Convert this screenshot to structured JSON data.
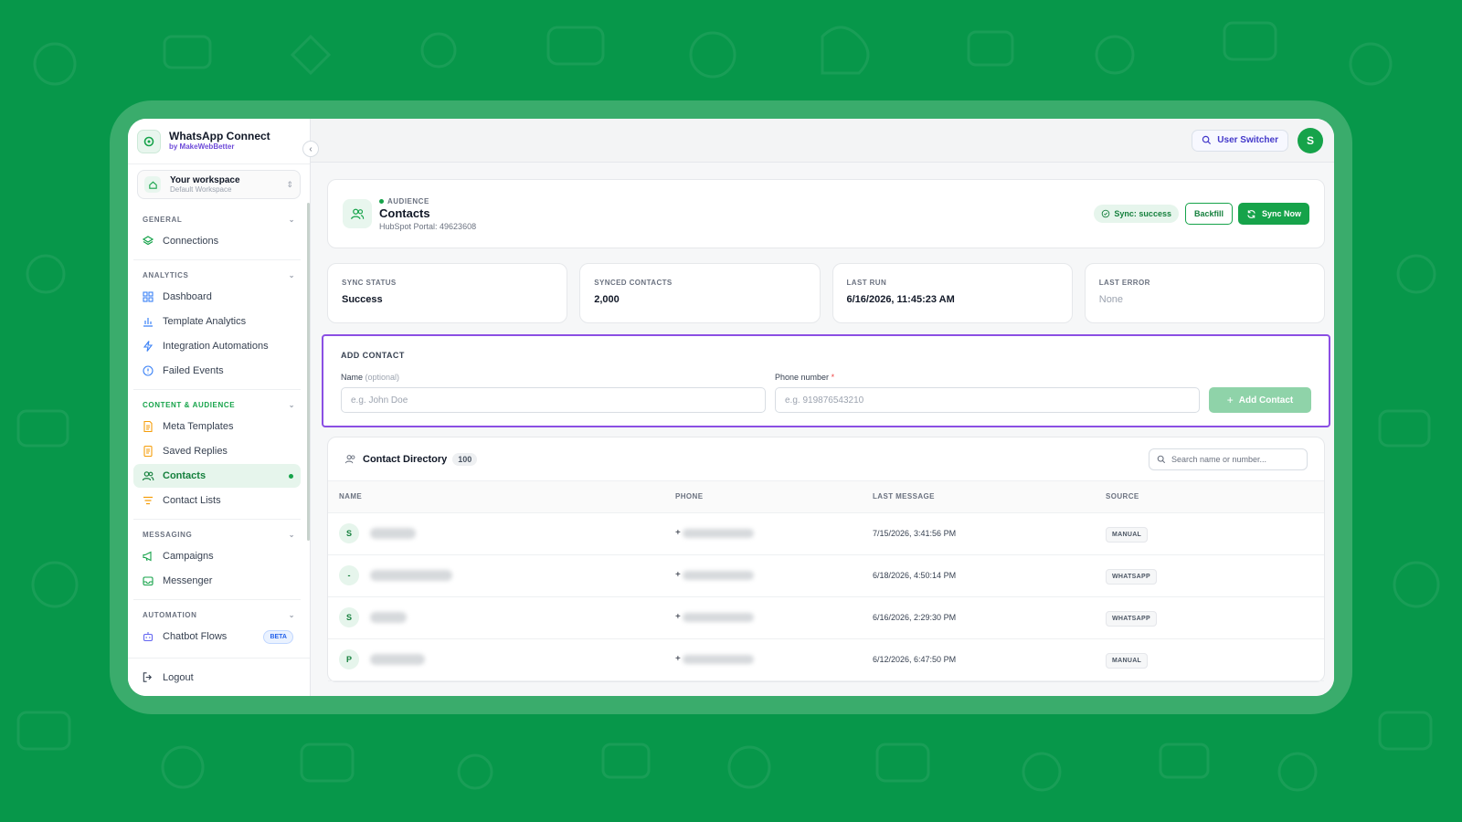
{
  "brand": {
    "title": "WhatsApp Connect",
    "subtitle": "by MakeWebBetter"
  },
  "workspace": {
    "name": "Your workspace",
    "sub": "Default Workspace"
  },
  "sidebar": {
    "sections": [
      {
        "label": "GENERAL",
        "items": [
          {
            "label": "Connections",
            "icon": "layers-icon"
          }
        ]
      },
      {
        "label": "ANALYTICS",
        "items": [
          {
            "label": "Dashboard",
            "icon": "dashboard-icon"
          },
          {
            "label": "Template Analytics",
            "icon": "bar-chart-icon"
          },
          {
            "label": "Integration Automations",
            "icon": "bolt-icon"
          },
          {
            "label": "Failed Events",
            "icon": "alert-circle-icon"
          }
        ]
      },
      {
        "label": "CONTENT & AUDIENCE",
        "items": [
          {
            "label": "Meta Templates",
            "icon": "document-icon"
          },
          {
            "label": "Saved Replies",
            "icon": "notes-icon"
          },
          {
            "label": "Contacts",
            "icon": "users-icon",
            "active": true
          },
          {
            "label": "Contact Lists",
            "icon": "list-filter-icon"
          }
        ]
      },
      {
        "label": "MESSAGING",
        "items": [
          {
            "label": "Campaigns",
            "icon": "megaphone-icon"
          },
          {
            "label": "Messenger",
            "icon": "inbox-icon"
          }
        ]
      },
      {
        "label": "AUTOMATION",
        "items": [
          {
            "label": "Chatbot Flows",
            "icon": "bot-icon",
            "badge": "BETA"
          }
        ]
      }
    ],
    "logout": "Logout"
  },
  "topbar": {
    "user_switcher": "User Switcher",
    "avatar_initial": "S"
  },
  "header": {
    "eyebrow": "AUDIENCE",
    "title": "Contacts",
    "subtitle": "HubSpot Portal: 49623608",
    "sync_pill": "Sync: success",
    "backfill": "Backfill",
    "sync_now": "Sync Now"
  },
  "stats": [
    {
      "label": "SYNC STATUS",
      "value": "Success"
    },
    {
      "label": "SYNCED CONTACTS",
      "value": "2,000"
    },
    {
      "label": "LAST RUN",
      "value": "6/16/2026, 11:45:23 AM"
    },
    {
      "label": "LAST ERROR",
      "value": "None"
    }
  ],
  "add_contact": {
    "title": "ADD CONTACT",
    "name_label": "Name",
    "name_optional": "(optional)",
    "name_placeholder": "e.g. John Doe",
    "phone_label": "Phone number",
    "phone_required": "*",
    "phone_placeholder": "e.g. 919876543210",
    "button": "Add Contact"
  },
  "directory": {
    "title": "Contact Directory",
    "count": "100",
    "search_placeholder": "Search name or number...",
    "columns": [
      "NAME",
      "PHONE",
      "LAST MESSAGE",
      "SOURCE"
    ],
    "rows": [
      {
        "initial": "S",
        "phone_prefix": "+",
        "last_message": "7/15/2026, 3:41:56 PM",
        "source": "MANUAL"
      },
      {
        "initial": "-",
        "phone_prefix": "+",
        "last_message": "6/18/2026, 4:50:14 PM",
        "source": "WHATSAPP"
      },
      {
        "initial": "S",
        "phone_prefix": "+",
        "last_message": "6/16/2026, 2:29:30 PM",
        "source": "WHATSAPP"
      },
      {
        "initial": "P",
        "phone_prefix": "+",
        "last_message": "6/12/2026, 6:47:50 PM",
        "source": "MANUAL"
      }
    ]
  },
  "colors": {
    "brand_green": "#16a34a",
    "background": "#07974a",
    "highlight": "#8b4fe3"
  }
}
